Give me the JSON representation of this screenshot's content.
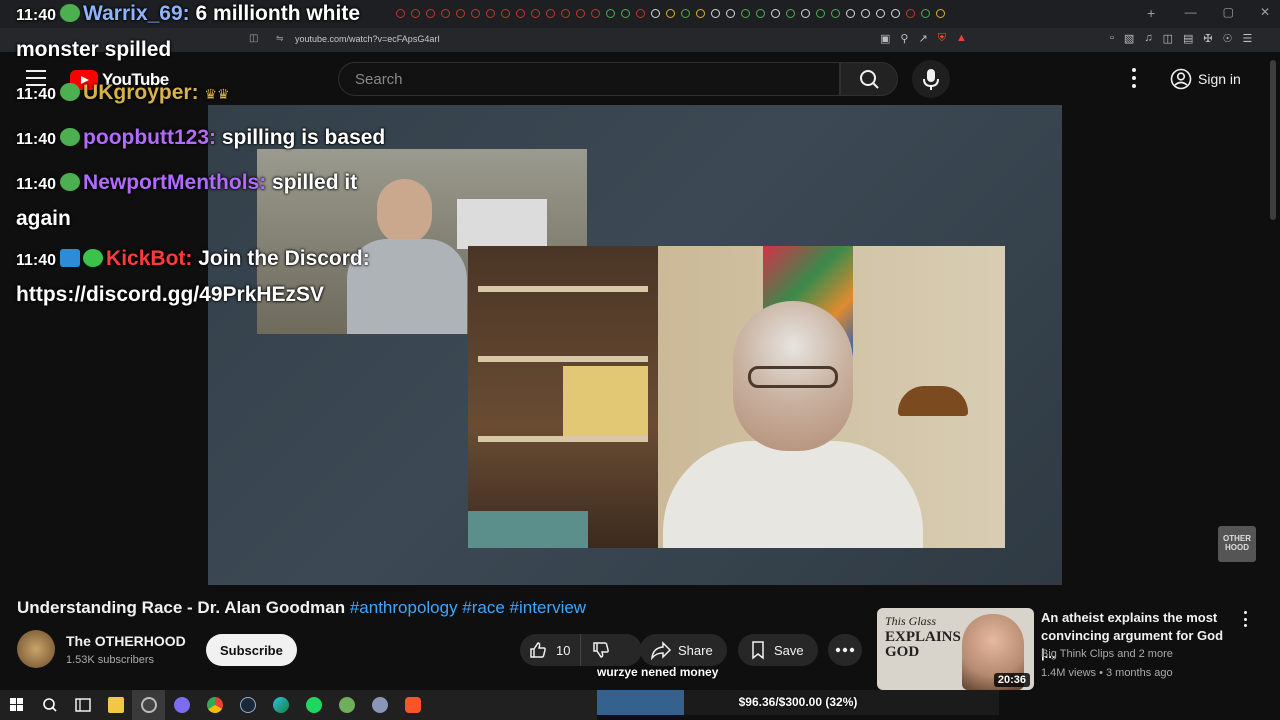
{
  "browser": {
    "url": "youtube.com/watch?v=ecFApsG4arI",
    "new_tab": "+",
    "win_min": "—",
    "win_max": "▢",
    "win_close": "✕"
  },
  "masthead": {
    "logo_text": "YouTube",
    "search_placeholder": "Search",
    "signin_label": "Sign in"
  },
  "chat": [
    {
      "time": "11:40",
      "user": "Warrix_69:",
      "user_color": "#8fb4ff",
      "text": "6 millionth white",
      "text2": "monster spilled"
    },
    {
      "time": "11:40",
      "user": "UKgroyper:",
      "user_color": "#d8b34a",
      "text": ""
    },
    {
      "time": "11:40",
      "user": "poopbutt123:",
      "user_color": "#b36bff",
      "text": "spilling is based"
    },
    {
      "time": "11:40",
      "user": "NewportMenthols:",
      "user_color": "#b36bff",
      "text": "spilled it",
      "text2": "again"
    },
    {
      "time": "11:40",
      "user": "KickBot:",
      "user_color": "#ff3b3b",
      "text": "Join the Discord:",
      "text2": "https://discord.gg/49PrkHEzSV"
    }
  ],
  "video": {
    "title": "Understanding Race - Dr. Alan Goodman",
    "tags": "#anthropology #race #interview",
    "watermark": "OTHER HOOD"
  },
  "channel": {
    "name": "The OTHERHOOD",
    "subscribers": "1.53K subscribers",
    "subscribe_label": "Subscribe"
  },
  "actions": {
    "likes": "10",
    "share_label": "Share",
    "save_label": "Save"
  },
  "recommended": {
    "thumb_line1": "This Glass",
    "thumb_line2": "EXPLAINS GOD",
    "duration": "20:36",
    "title": "An atheist explains the most convincing argument for God |...",
    "channel": "Big Think Clips and 2 more",
    "meta": "1.4M views • 3 months ago"
  },
  "stream": {
    "tts_text": "wurzye nened money",
    "goal_text": "$96.36/$300.00 (32%)",
    "goal_fraction": 0.32
  }
}
